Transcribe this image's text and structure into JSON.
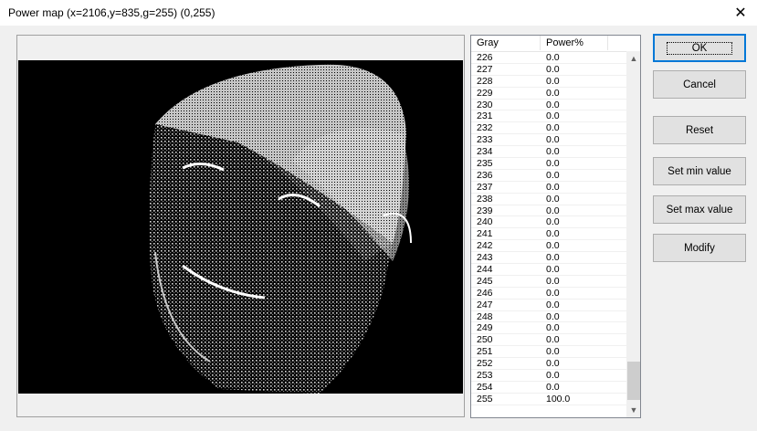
{
  "window": {
    "title": "Power map (x=2106,y=835,g=255) (0,255)",
    "close_glyph": "✕"
  },
  "list": {
    "columns": [
      "Gray",
      "Power%"
    ],
    "rows": [
      {
        "gray": "226",
        "power": "0.0"
      },
      {
        "gray": "227",
        "power": "0.0"
      },
      {
        "gray": "228",
        "power": "0.0"
      },
      {
        "gray": "229",
        "power": "0.0"
      },
      {
        "gray": "230",
        "power": "0.0"
      },
      {
        "gray": "231",
        "power": "0.0"
      },
      {
        "gray": "232",
        "power": "0.0"
      },
      {
        "gray": "233",
        "power": "0.0"
      },
      {
        "gray": "234",
        "power": "0.0"
      },
      {
        "gray": "235",
        "power": "0.0"
      },
      {
        "gray": "236",
        "power": "0.0"
      },
      {
        "gray": "237",
        "power": "0.0"
      },
      {
        "gray": "238",
        "power": "0.0"
      },
      {
        "gray": "239",
        "power": "0.0"
      },
      {
        "gray": "240",
        "power": "0.0"
      },
      {
        "gray": "241",
        "power": "0.0"
      },
      {
        "gray": "242",
        "power": "0.0"
      },
      {
        "gray": "243",
        "power": "0.0"
      },
      {
        "gray": "244",
        "power": "0.0"
      },
      {
        "gray": "245",
        "power": "0.0"
      },
      {
        "gray": "246",
        "power": "0.0"
      },
      {
        "gray": "247",
        "power": "0.0"
      },
      {
        "gray": "248",
        "power": "0.0"
      },
      {
        "gray": "249",
        "power": "0.0"
      },
      {
        "gray": "250",
        "power": "0.0"
      },
      {
        "gray": "251",
        "power": "0.0"
      },
      {
        "gray": "252",
        "power": "0.0"
      },
      {
        "gray": "253",
        "power": "0.0"
      },
      {
        "gray": "254",
        "power": "0.0"
      },
      {
        "gray": "255",
        "power": "100.0"
      }
    ]
  },
  "buttons": {
    "ok": "OK",
    "cancel": "Cancel",
    "reset": "Reset",
    "set_min": "Set min value",
    "set_max": "Set max value",
    "modify": "Modify"
  },
  "icons": {
    "scroll_up": "scroll-up-arrow-icon",
    "scroll_down": "scroll-down-arrow-icon",
    "close": "close-icon"
  }
}
